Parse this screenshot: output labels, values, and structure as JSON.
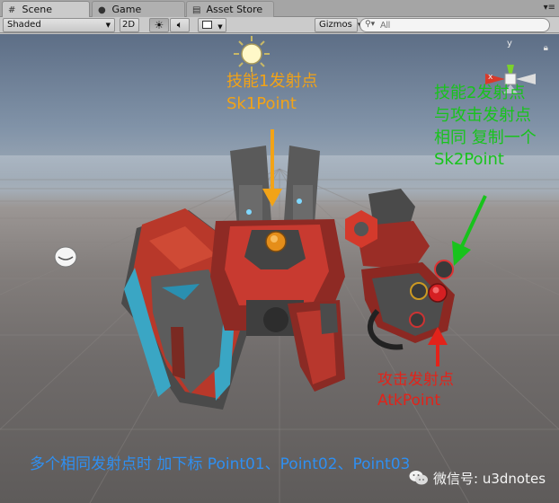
{
  "tabs": [
    {
      "label": "Scene",
      "icon": "scene-grid-icon",
      "active": true
    },
    {
      "label": "Game",
      "icon": "game-pacman-icon",
      "active": false
    },
    {
      "label": "Asset Store",
      "icon": "shopping-bag-icon",
      "active": false
    }
  ],
  "toolbar": {
    "draw_mode": "Shaded",
    "mode_2d": "2D",
    "gizmos": "Gizmos",
    "search_placeholder": "All"
  },
  "annotations": {
    "sk1_line1": "技能1发射点",
    "sk1_line2": "Sk1Point",
    "sk2_line1": "技能2发射点",
    "sk2_line2": "与攻击发射点",
    "sk2_line3": "相同 复制一个",
    "sk2_line4": "Sk2Point",
    "atk_line1": "攻击发射点",
    "atk_line2": "AtkPoint",
    "bottom_note": "多个相同发射点时 加下标 Point01、Point02、Point03"
  },
  "gizmo_axes": {
    "x": "x",
    "y": "y"
  },
  "watermark": "微信号: u3dnotes",
  "colors": {
    "orange": "#f2a317",
    "green": "#18c31c",
    "red": "#e2231a",
    "blue": "#2f8ff1"
  }
}
